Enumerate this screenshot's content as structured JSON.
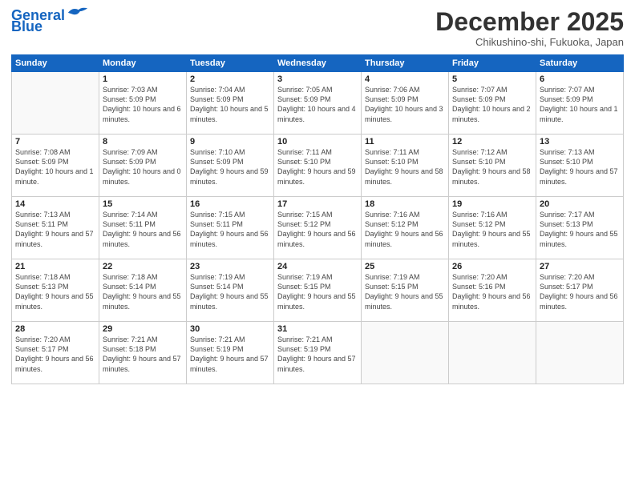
{
  "header": {
    "logo_line1": "General",
    "logo_line2": "Blue",
    "month": "December 2025",
    "location": "Chikushino-shi, Fukuoka, Japan"
  },
  "weekdays": [
    "Sunday",
    "Monday",
    "Tuesday",
    "Wednesday",
    "Thursday",
    "Friday",
    "Saturday"
  ],
  "weeks": [
    [
      {
        "day": "",
        "sunrise": "",
        "sunset": "",
        "daylight": ""
      },
      {
        "day": "1",
        "sunrise": "Sunrise: 7:03 AM",
        "sunset": "Sunset: 5:09 PM",
        "daylight": "Daylight: 10 hours and 6 minutes."
      },
      {
        "day": "2",
        "sunrise": "Sunrise: 7:04 AM",
        "sunset": "Sunset: 5:09 PM",
        "daylight": "Daylight: 10 hours and 5 minutes."
      },
      {
        "day": "3",
        "sunrise": "Sunrise: 7:05 AM",
        "sunset": "Sunset: 5:09 PM",
        "daylight": "Daylight: 10 hours and 4 minutes."
      },
      {
        "day": "4",
        "sunrise": "Sunrise: 7:06 AM",
        "sunset": "Sunset: 5:09 PM",
        "daylight": "Daylight: 10 hours and 3 minutes."
      },
      {
        "day": "5",
        "sunrise": "Sunrise: 7:07 AM",
        "sunset": "Sunset: 5:09 PM",
        "daylight": "Daylight: 10 hours and 2 minutes."
      },
      {
        "day": "6",
        "sunrise": "Sunrise: 7:07 AM",
        "sunset": "Sunset: 5:09 PM",
        "daylight": "Daylight: 10 hours and 1 minute."
      }
    ],
    [
      {
        "day": "7",
        "sunrise": "Sunrise: 7:08 AM",
        "sunset": "Sunset: 5:09 PM",
        "daylight": "Daylight: 10 hours and 1 minute."
      },
      {
        "day": "8",
        "sunrise": "Sunrise: 7:09 AM",
        "sunset": "Sunset: 5:09 PM",
        "daylight": "Daylight: 10 hours and 0 minutes."
      },
      {
        "day": "9",
        "sunrise": "Sunrise: 7:10 AM",
        "sunset": "Sunset: 5:09 PM",
        "daylight": "Daylight: 9 hours and 59 minutes."
      },
      {
        "day": "10",
        "sunrise": "Sunrise: 7:11 AM",
        "sunset": "Sunset: 5:10 PM",
        "daylight": "Daylight: 9 hours and 59 minutes."
      },
      {
        "day": "11",
        "sunrise": "Sunrise: 7:11 AM",
        "sunset": "Sunset: 5:10 PM",
        "daylight": "Daylight: 9 hours and 58 minutes."
      },
      {
        "day": "12",
        "sunrise": "Sunrise: 7:12 AM",
        "sunset": "Sunset: 5:10 PM",
        "daylight": "Daylight: 9 hours and 58 minutes."
      },
      {
        "day": "13",
        "sunrise": "Sunrise: 7:13 AM",
        "sunset": "Sunset: 5:10 PM",
        "daylight": "Daylight: 9 hours and 57 minutes."
      }
    ],
    [
      {
        "day": "14",
        "sunrise": "Sunrise: 7:13 AM",
        "sunset": "Sunset: 5:11 PM",
        "daylight": "Daylight: 9 hours and 57 minutes."
      },
      {
        "day": "15",
        "sunrise": "Sunrise: 7:14 AM",
        "sunset": "Sunset: 5:11 PM",
        "daylight": "Daylight: 9 hours and 56 minutes."
      },
      {
        "day": "16",
        "sunrise": "Sunrise: 7:15 AM",
        "sunset": "Sunset: 5:11 PM",
        "daylight": "Daylight: 9 hours and 56 minutes."
      },
      {
        "day": "17",
        "sunrise": "Sunrise: 7:15 AM",
        "sunset": "Sunset: 5:12 PM",
        "daylight": "Daylight: 9 hours and 56 minutes."
      },
      {
        "day": "18",
        "sunrise": "Sunrise: 7:16 AM",
        "sunset": "Sunset: 5:12 PM",
        "daylight": "Daylight: 9 hours and 56 minutes."
      },
      {
        "day": "19",
        "sunrise": "Sunrise: 7:16 AM",
        "sunset": "Sunset: 5:12 PM",
        "daylight": "Daylight: 9 hours and 55 minutes."
      },
      {
        "day": "20",
        "sunrise": "Sunrise: 7:17 AM",
        "sunset": "Sunset: 5:13 PM",
        "daylight": "Daylight: 9 hours and 55 minutes."
      }
    ],
    [
      {
        "day": "21",
        "sunrise": "Sunrise: 7:18 AM",
        "sunset": "Sunset: 5:13 PM",
        "daylight": "Daylight: 9 hours and 55 minutes."
      },
      {
        "day": "22",
        "sunrise": "Sunrise: 7:18 AM",
        "sunset": "Sunset: 5:14 PM",
        "daylight": "Daylight: 9 hours and 55 minutes."
      },
      {
        "day": "23",
        "sunrise": "Sunrise: 7:19 AM",
        "sunset": "Sunset: 5:14 PM",
        "daylight": "Daylight: 9 hours and 55 minutes."
      },
      {
        "day": "24",
        "sunrise": "Sunrise: 7:19 AM",
        "sunset": "Sunset: 5:15 PM",
        "daylight": "Daylight: 9 hours and 55 minutes."
      },
      {
        "day": "25",
        "sunrise": "Sunrise: 7:19 AM",
        "sunset": "Sunset: 5:15 PM",
        "daylight": "Daylight: 9 hours and 55 minutes."
      },
      {
        "day": "26",
        "sunrise": "Sunrise: 7:20 AM",
        "sunset": "Sunset: 5:16 PM",
        "daylight": "Daylight: 9 hours and 56 minutes."
      },
      {
        "day": "27",
        "sunrise": "Sunrise: 7:20 AM",
        "sunset": "Sunset: 5:17 PM",
        "daylight": "Daylight: 9 hours and 56 minutes."
      }
    ],
    [
      {
        "day": "28",
        "sunrise": "Sunrise: 7:20 AM",
        "sunset": "Sunset: 5:17 PM",
        "daylight": "Daylight: 9 hours and 56 minutes."
      },
      {
        "day": "29",
        "sunrise": "Sunrise: 7:21 AM",
        "sunset": "Sunset: 5:18 PM",
        "daylight": "Daylight: 9 hours and 57 minutes."
      },
      {
        "day": "30",
        "sunrise": "Sunrise: 7:21 AM",
        "sunset": "Sunset: 5:19 PM",
        "daylight": "Daylight: 9 hours and 57 minutes."
      },
      {
        "day": "31",
        "sunrise": "Sunrise: 7:21 AM",
        "sunset": "Sunset: 5:19 PM",
        "daylight": "Daylight: 9 hours and 57 minutes."
      },
      {
        "day": "",
        "sunrise": "",
        "sunset": "",
        "daylight": ""
      },
      {
        "day": "",
        "sunrise": "",
        "sunset": "",
        "daylight": ""
      },
      {
        "day": "",
        "sunrise": "",
        "sunset": "",
        "daylight": ""
      }
    ]
  ]
}
